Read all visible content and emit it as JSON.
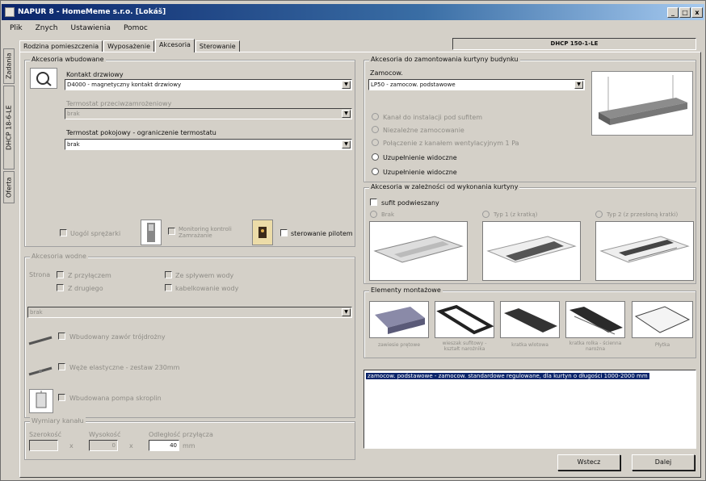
{
  "window": {
    "title": "NAPUR 8 - HomeMeme s.r.o. [Lokáš]",
    "buttons": {
      "minimize": "_",
      "maximize": "□",
      "close": "x"
    }
  },
  "menu": [
    "Plik",
    "Znych",
    "Ustawienia",
    "Pomoc"
  ],
  "vertical_tabs": [
    "Zadania",
    "DHCP 18-6-LE",
    "Oferta"
  ],
  "tabs": [
    "Rodzina pomieszczenia",
    "Wyposażenie",
    "Akcesoria",
    "Sterowanie"
  ],
  "active_tab": 2,
  "status_box": "DHCP 150-1-LE",
  "left": {
    "group1": {
      "title": "Akcesoria wbudowane",
      "contact_label": "Kontakt drzwiowy",
      "contact_value": "D4000 - magnetyczny kontakt drzwiowy",
      "term1_label": "Termostat przeciwzamrożeniowy",
      "term1_value": "brak",
      "term2_label": "Termostat pokojowy - ograniczenie termostatu",
      "term2_value": "brak",
      "chk1": "Uogól sprężarki",
      "chk2": "Monitoring kontroli Zamrażanie",
      "chk3": "sterowanie pilotem"
    },
    "group2": {
      "title": "Akcesoria wodne",
      "side_label": "Strona",
      "col1": [
        "Z przyłączem",
        "Z drugiego"
      ],
      "col2": [
        "Ze spływem wody",
        "kabelkowanie wody"
      ],
      "combo_value": "brak",
      "item1": "Wbudowany zawór trójdrożny",
      "item2": "Węże elastyczne - zestaw 230mm",
      "item3": "Wbudowana pompa skroplin"
    },
    "group3": {
      "title": "Wymiary kanału",
      "w_label": "Szerokość",
      "w_value": "",
      "h_label": "Wysokość",
      "h_value": "0",
      "f_label": "Odległość przyłącza",
      "f_value": "40",
      "unit": "mm",
      "sep": "x"
    }
  },
  "right": {
    "group1": {
      "title": "Akcesoria do zamontowania kurtyny budynku",
      "sub_label": "Zamocow.",
      "sub_value": "LP50 - zamocow. podstawowe",
      "options": [
        {
          "label": "Kanał do instalacji pod sufitem",
          "disabled": true
        },
        {
          "label": "Niezależne zamocowanie",
          "disabled": true
        },
        {
          "label": "Połączenie z kanałem wentylacyjnym 1 Pa",
          "disabled": true
        },
        {
          "label": "Uzupełnienie widoczne",
          "disabled": false
        },
        {
          "label": "Uzupełnienie widoczne",
          "disabled": false
        }
      ]
    },
    "group2": {
      "title": "Akcesoria w zależności od wykonania kurtyny",
      "chk_label": "sufit podwieszany",
      "opts": [
        "Brak",
        "Typ 1 (z kratką)",
        "Typ 2 (z przesłoną kratki)"
      ]
    },
    "group3": {
      "title": "Elementy montażowe",
      "items": [
        "zawiesie prętowe",
        "wieszak sufitowy - kształt narożnika",
        "kratka wlotowa",
        "kratka rolka - ścienna narożna",
        "Płytka"
      ]
    },
    "selection_text": "zamocow. podstawowe - zamocow. standardowe regulowane, dla kurtyn o długości 1000-2000 mm"
  },
  "buttons": {
    "ok": "Wstecz",
    "next": "Dalej"
  },
  "colors": {
    "title_start": "#0a246a",
    "title_end": "#a6caf0",
    "face": "#d4d0c8",
    "select": "#0a246a"
  }
}
